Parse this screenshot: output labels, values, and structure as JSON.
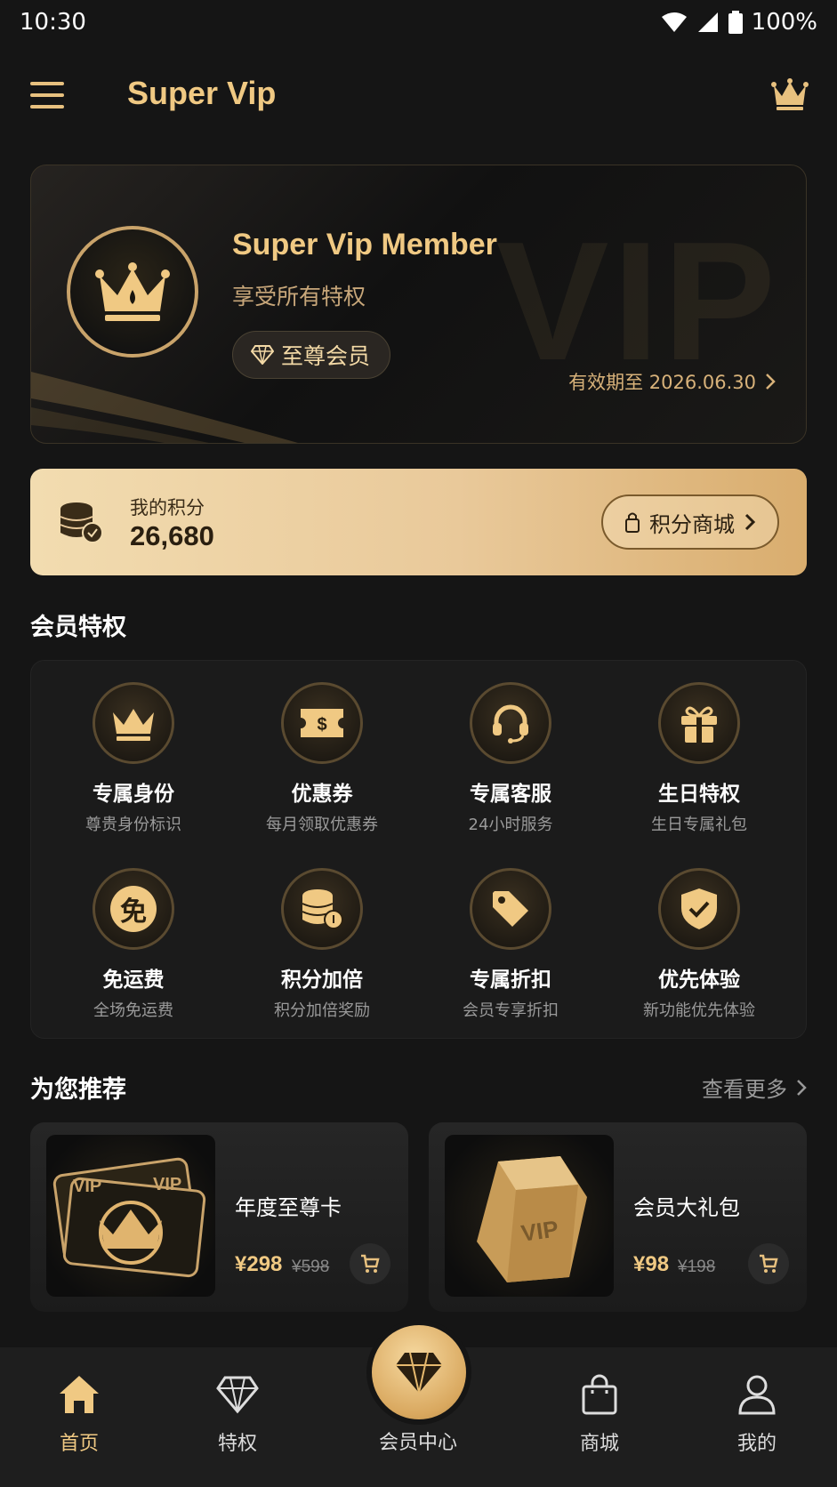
{
  "status_bar": {
    "time": "10:30",
    "battery": "100%"
  },
  "app_bar": {
    "title": "Super Vip"
  },
  "member_card": {
    "name": "Super Vip Member",
    "subtitle": "享受所有特权",
    "badge": "至尊会员",
    "expiry": "有效期至 2026.06.30",
    "watermark": "VIP"
  },
  "points": {
    "label": "我的积分",
    "value": "26,680",
    "mall_button": "积分商城"
  },
  "privileges": {
    "title": "会员特权",
    "items": [
      {
        "name": "专属身份",
        "desc": "尊贵身份标识",
        "icon": "crown-icon"
      },
      {
        "name": "优惠券",
        "desc": "每月领取优惠券",
        "icon": "coupon-icon"
      },
      {
        "name": "专属客服",
        "desc": "24小时服务",
        "icon": "headset-icon"
      },
      {
        "name": "生日特权",
        "desc": "生日专属礼包",
        "icon": "gift-icon"
      },
      {
        "name": "免运费",
        "desc": "全场免运费",
        "icon": "free-shipping-icon",
        "glyph": "免"
      },
      {
        "name": "积分加倍",
        "desc": "积分加倍奖励",
        "icon": "coins-icon"
      },
      {
        "name": "专属折扣",
        "desc": "会员专享折扣",
        "icon": "tag-icon"
      },
      {
        "name": "优先体验",
        "desc": "新功能优先体验",
        "icon": "shield-check-icon"
      }
    ]
  },
  "recommend": {
    "title": "为您推荐",
    "see_more": "查看更多",
    "products": [
      {
        "name": "年度至尊卡",
        "price": "¥298",
        "original_price": "¥598"
      },
      {
        "name": "会员大礼包",
        "price": "¥98",
        "original_price": "¥198"
      }
    ]
  },
  "bottom_nav": {
    "items": [
      {
        "label": "首页",
        "active": true
      },
      {
        "label": "特权",
        "active": false
      },
      {
        "label": "会员中心",
        "active": false
      },
      {
        "label": "商城",
        "active": false
      },
      {
        "label": "我的",
        "active": false
      }
    ]
  },
  "colors": {
    "gold": "#f0c983",
    "background": "#151515",
    "card": "#1b1b1b"
  }
}
